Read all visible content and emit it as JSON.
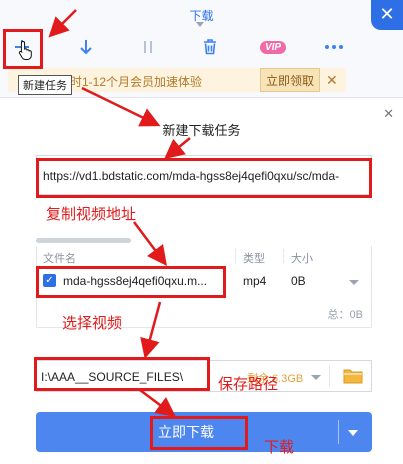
{
  "topbar": {
    "title": "下载",
    "toolbar": {
      "new_task_icon": "plus-icon",
      "download_icon": "download-arrow-icon",
      "pause_icon": "pause-icon",
      "delete_icon": "trash-icon",
      "vip_label": "VIP",
      "more_icon": "more-dots-icon"
    },
    "tooltip": "新建任务",
    "promo": {
      "text": "限时1-12个月会员加速体验",
      "button": "立即领取",
      "close": "✕"
    }
  },
  "dialog": {
    "title": "新建下载任务",
    "close": "✕",
    "url_value": "https://vd1.bdstatic.com/mda-hgss8ej4qefi0qxu/sc/mda-",
    "table": {
      "headers": [
        "文件名",
        "类型",
        "大小"
      ],
      "row": {
        "name": "mda-hgss8ej4qefi0qxu.m...",
        "type": "mp4",
        "size": "0B"
      },
      "total": "总：0B"
    },
    "path": {
      "value": "I:\\AAA__SOURCE_FILES\\",
      "free": "剩余:6.3GB"
    },
    "download_button": "立即下载"
  },
  "annotations": {
    "copy_url": "复制视频地址",
    "select_video": "选择视频",
    "save_path": "保存路径",
    "download": "下载"
  },
  "colors": {
    "accent": "#2f6fe6",
    "button": "#4e86ef",
    "annotation": "#e11b1b",
    "vip": "#f06aa7",
    "promo_bg": "#fdf3de"
  }
}
